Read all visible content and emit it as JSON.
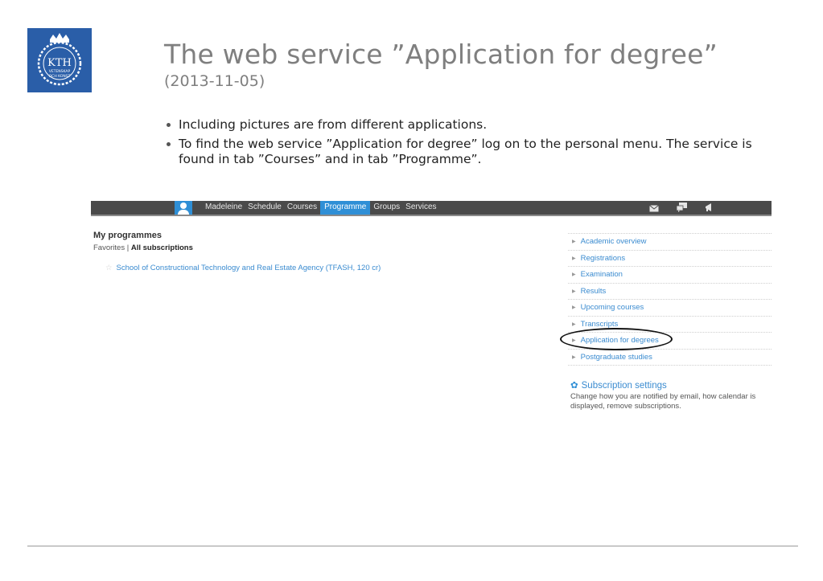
{
  "slide": {
    "logo_text": "KTH",
    "logo_sub1": "VETENSKAP",
    "logo_sub2": "OCH KONST",
    "title": "The web service ”Application for degree”",
    "subtitle": "(2013-11-05)",
    "bullets": [
      "Including pictures are from different applications.",
      "To find the web service ”Application for degree” log on to the personal menu. The service is found in tab ”Courses” and in tab ”Programme”."
    ]
  },
  "topbar": {
    "nav": [
      "Madeleine",
      "Schedule",
      "Courses",
      "Programme",
      "Groups",
      "Services"
    ],
    "active": "Programme",
    "icons": [
      "mail-icon",
      "chat-icon",
      "megaphone-icon"
    ]
  },
  "main": {
    "heading": "My programmes",
    "filter_favorites": "Favorites",
    "filter_sep": "|",
    "filter_all": "All subscriptions",
    "programme": "School of Constructional Technology and Real Estate Agency (TFASH, 120 cr)"
  },
  "sidemenu": {
    "items": [
      "Academic overview",
      "Registrations",
      "Examination",
      "Results",
      "Upcoming courses",
      "Transcripts",
      "Application for degrees",
      "Postgraduate studies"
    ],
    "highlighted": "Application for degrees"
  },
  "subscription": {
    "title": "Subscription settings",
    "text": "Change how you are notified by email, how calendar is displayed, remove subscriptions."
  },
  "colors": {
    "accent": "#2f8fd6",
    "link": "#3a8bd0",
    "topbar": "#4a4a4a",
    "logo": "#2a5ea8"
  }
}
